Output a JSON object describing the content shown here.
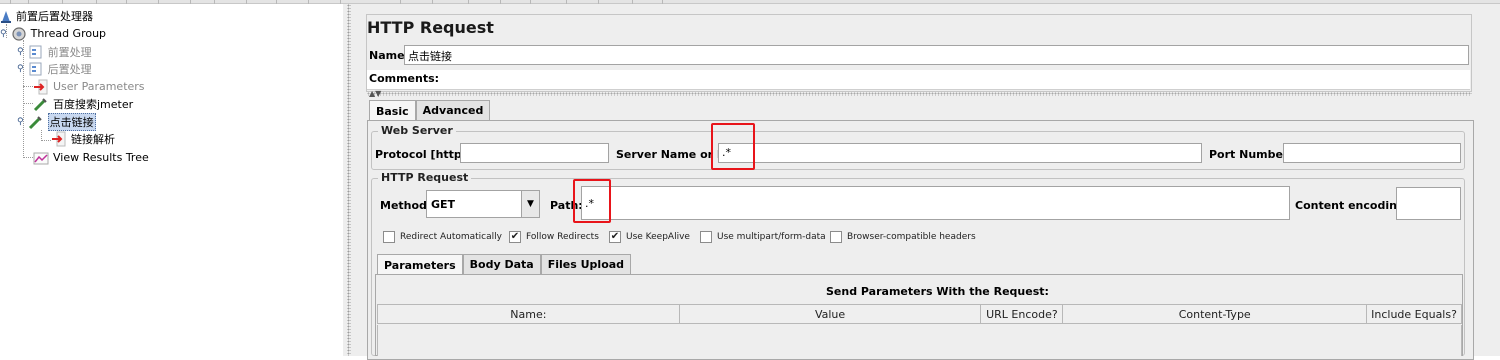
{
  "tree": {
    "root": "前置后置处理器",
    "thread_group": "Thread Group",
    "pre_processor": "前置处理",
    "post_processor": "后置处理",
    "user_parameters": "User Parameters",
    "baidu_search": "百度搜索jmeter",
    "click_link": "点击链接",
    "link_parse": "链接解析",
    "view_results_tree": "View Results Tree"
  },
  "panel": {
    "title": "HTTP Request",
    "name_label": "Name:",
    "name_value": "点击链接",
    "comments_label": "Comments:"
  },
  "tabs": {
    "basic": "Basic",
    "advanced": "Advanced"
  },
  "web_server": {
    "title": "Web Server",
    "protocol_label": "Protocol [http]:",
    "protocol_value": "",
    "server_label": "Server Name or IP:",
    "server_value": ".*",
    "port_label": "Port Number:",
    "port_value": ""
  },
  "http_request": {
    "title": "HTTP Request",
    "method_label": "Method:",
    "method_value": "GET",
    "path_label": "Path:",
    "path_value": ".*",
    "encoding_label": "Content encoding:",
    "encoding_value": ""
  },
  "options": [
    {
      "label": "Redirect Automatically",
      "checked": false
    },
    {
      "label": "Follow Redirects",
      "checked": true
    },
    {
      "label": "Use KeepAlive",
      "checked": true
    },
    {
      "label": "Use multipart/form-data",
      "checked": false
    },
    {
      "label": "Browser-compatible headers",
      "checked": false
    }
  ],
  "param_tabs": {
    "parameters": "Parameters",
    "body_data": "Body Data",
    "files_upload": "Files Upload"
  },
  "params_table": {
    "caption": "Send Parameters With the Request:",
    "columns": [
      "Name:",
      "Value",
      "URL Encode?",
      "Content-Type",
      "Include Equals?"
    ]
  },
  "colors": {
    "highlight": "#e8141a",
    "panel_bg": "#eeeeee",
    "selection": "#c8d8f0"
  }
}
